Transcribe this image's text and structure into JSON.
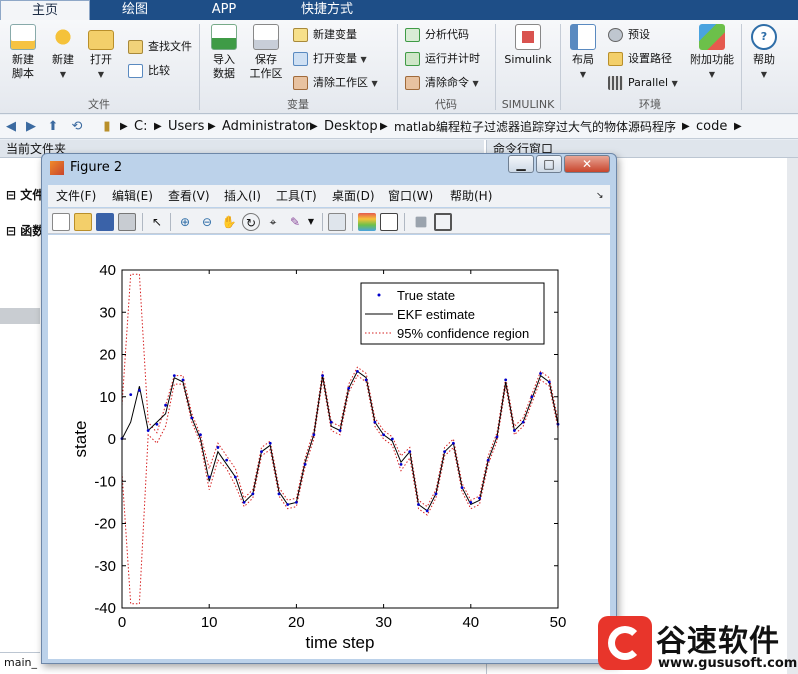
{
  "ribbon_tabs": [
    "主页",
    "绘图",
    "APP",
    "快捷方式"
  ],
  "ribbon": {
    "file_group": {
      "label": "文件",
      "new_script": "新建\n脚本",
      "new": "新建",
      "open": "打开",
      "find_files": "查找文件",
      "compare": "比较"
    },
    "variable_group": {
      "label": "变量",
      "import": "导入\n数据",
      "save_ws": "保存\n工作区",
      "new_var": "新建变量",
      "open_var": "打开变量",
      "clear_ws": "清除工作区"
    },
    "code_group": {
      "label": "代码",
      "analyze": "分析代码",
      "run_time": "运行并计时",
      "clear_cmds": "清除命令"
    },
    "simulink_group": {
      "label": "SIMULINK",
      "simulink": "Simulink"
    },
    "env_group": {
      "label": "环境",
      "layout": "布局",
      "prefs": "预设",
      "set_path": "设置路径",
      "parallel": "Parallel",
      "addons": "附加功能"
    },
    "help": "帮助"
  },
  "address": {
    "crumbs": [
      "C:",
      "Users",
      "Administrator",
      "Desktop",
      "matlab编程粒子过滤器追踪穿过大气的物体源码程序",
      "code"
    ]
  },
  "left_panel": {
    "title": "当前文件夹",
    "tree_items": [
      "文件",
      "函数"
    ],
    "status": "main_"
  },
  "cmd_panel": {
    "title": "命令行窗口"
  },
  "figure": {
    "title": "Figure 2",
    "menu": [
      "文件(F)",
      "编辑(E)",
      "查看(V)",
      "插入(I)",
      "工具(T)",
      "桌面(D)",
      "窗口(W)",
      "帮助(H)"
    ]
  },
  "colors": {
    "true_state": "#0000cc",
    "ekf": "#000000",
    "confidence": "#d62020"
  },
  "chart_data": {
    "type": "line",
    "xlabel": "time step",
    "ylabel": "state",
    "xlim": [
      0,
      50
    ],
    "ylim": [
      -40,
      40
    ],
    "xticks": [
      0,
      10,
      20,
      30,
      40,
      50
    ],
    "yticks": [
      -40,
      -30,
      -20,
      -10,
      0,
      10,
      20,
      30,
      40
    ],
    "legend_position": "top-right",
    "legend": [
      "True state",
      "EKF estimate",
      "95% confidence region"
    ],
    "x": [
      0,
      1,
      2,
      3,
      4,
      5,
      6,
      7,
      8,
      9,
      10,
      11,
      12,
      13,
      14,
      15,
      16,
      17,
      18,
      19,
      20,
      21,
      22,
      23,
      24,
      25,
      26,
      27,
      28,
      29,
      30,
      31,
      32,
      33,
      34,
      35,
      36,
      37,
      38,
      39,
      40,
      41,
      42,
      43,
      44,
      45,
      46,
      47,
      48,
      49,
      50
    ],
    "series": [
      {
        "name": "True state",
        "style": "points",
        "values": [
          0.1,
          10.5,
          11.5,
          2,
          3.5,
          8,
          15,
          14,
          5,
          1,
          -9,
          -2,
          -5,
          -9,
          -15,
          -13,
          -3,
          -1,
          -13,
          -15.5,
          -15,
          -6,
          1,
          15,
          4,
          2,
          12,
          16,
          14,
          4,
          1,
          0,
          -6,
          -3,
          -15.5,
          -17,
          -13,
          -3,
          -1,
          -11.5,
          -15,
          -14,
          -5,
          0.5,
          14,
          2,
          4,
          10,
          15.5,
          13.5,
          3.5
        ]
      },
      {
        "name": "EKF estimate",
        "style": "solid",
        "values": [
          0,
          4,
          12.5,
          2,
          4,
          6,
          14.5,
          13.5,
          5,
          0,
          -10,
          -3,
          -6,
          -9,
          -15,
          -13,
          -3,
          -1.5,
          -12.5,
          -15.5,
          -15,
          -5.5,
          1,
          15,
          3,
          2,
          12,
          16,
          14.5,
          4,
          1,
          -0.5,
          -5.5,
          -3,
          -15.5,
          -17,
          -13,
          -3,
          -1,
          -11.5,
          -15.5,
          -14.5,
          -5,
          0.5,
          13.5,
          2,
          4,
          9.5,
          15,
          13.5,
          3.5
        ]
      }
    ],
    "confidence": {
      "upper": [
        8,
        39,
        39,
        4,
        1.5,
        8,
        15,
        15,
        6,
        1,
        -7,
        -1,
        -4,
        -7,
        -14,
        -12,
        -2,
        -0.5,
        -11.5,
        -14.5,
        -14,
        -4.5,
        2,
        16,
        4,
        3,
        13,
        17,
        15.5,
        5,
        2,
        0.5,
        -4,
        -2,
        -14.5,
        -16,
        -12,
        -2,
        0,
        -10.5,
        -14.5,
        -13.5,
        -4,
        1.5,
        14.5,
        3,
        5,
        10.5,
        16,
        14.5,
        4.5
      ],
      "lower": [
        -8,
        -39,
        -39,
        1,
        -1,
        3,
        13,
        13,
        4,
        -1,
        -12,
        -5,
        -7,
        -11,
        -16,
        -14,
        -4,
        -2.5,
        -13.5,
        -16.5,
        -16,
        -6.5,
        0,
        14,
        2,
        1,
        11,
        15,
        13.5,
        3,
        0,
        -1.5,
        -7.5,
        -4.5,
        -16.5,
        -18,
        -14,
        -4,
        -2,
        -12.5,
        -16.5,
        -15.5,
        -6,
        -0.5,
        12.5,
        1,
        3,
        8.5,
        14,
        12.5,
        2.5
      ]
    }
  },
  "watermark": {
    "name": "谷速软件",
    "url": "www.gususoft.com"
  }
}
